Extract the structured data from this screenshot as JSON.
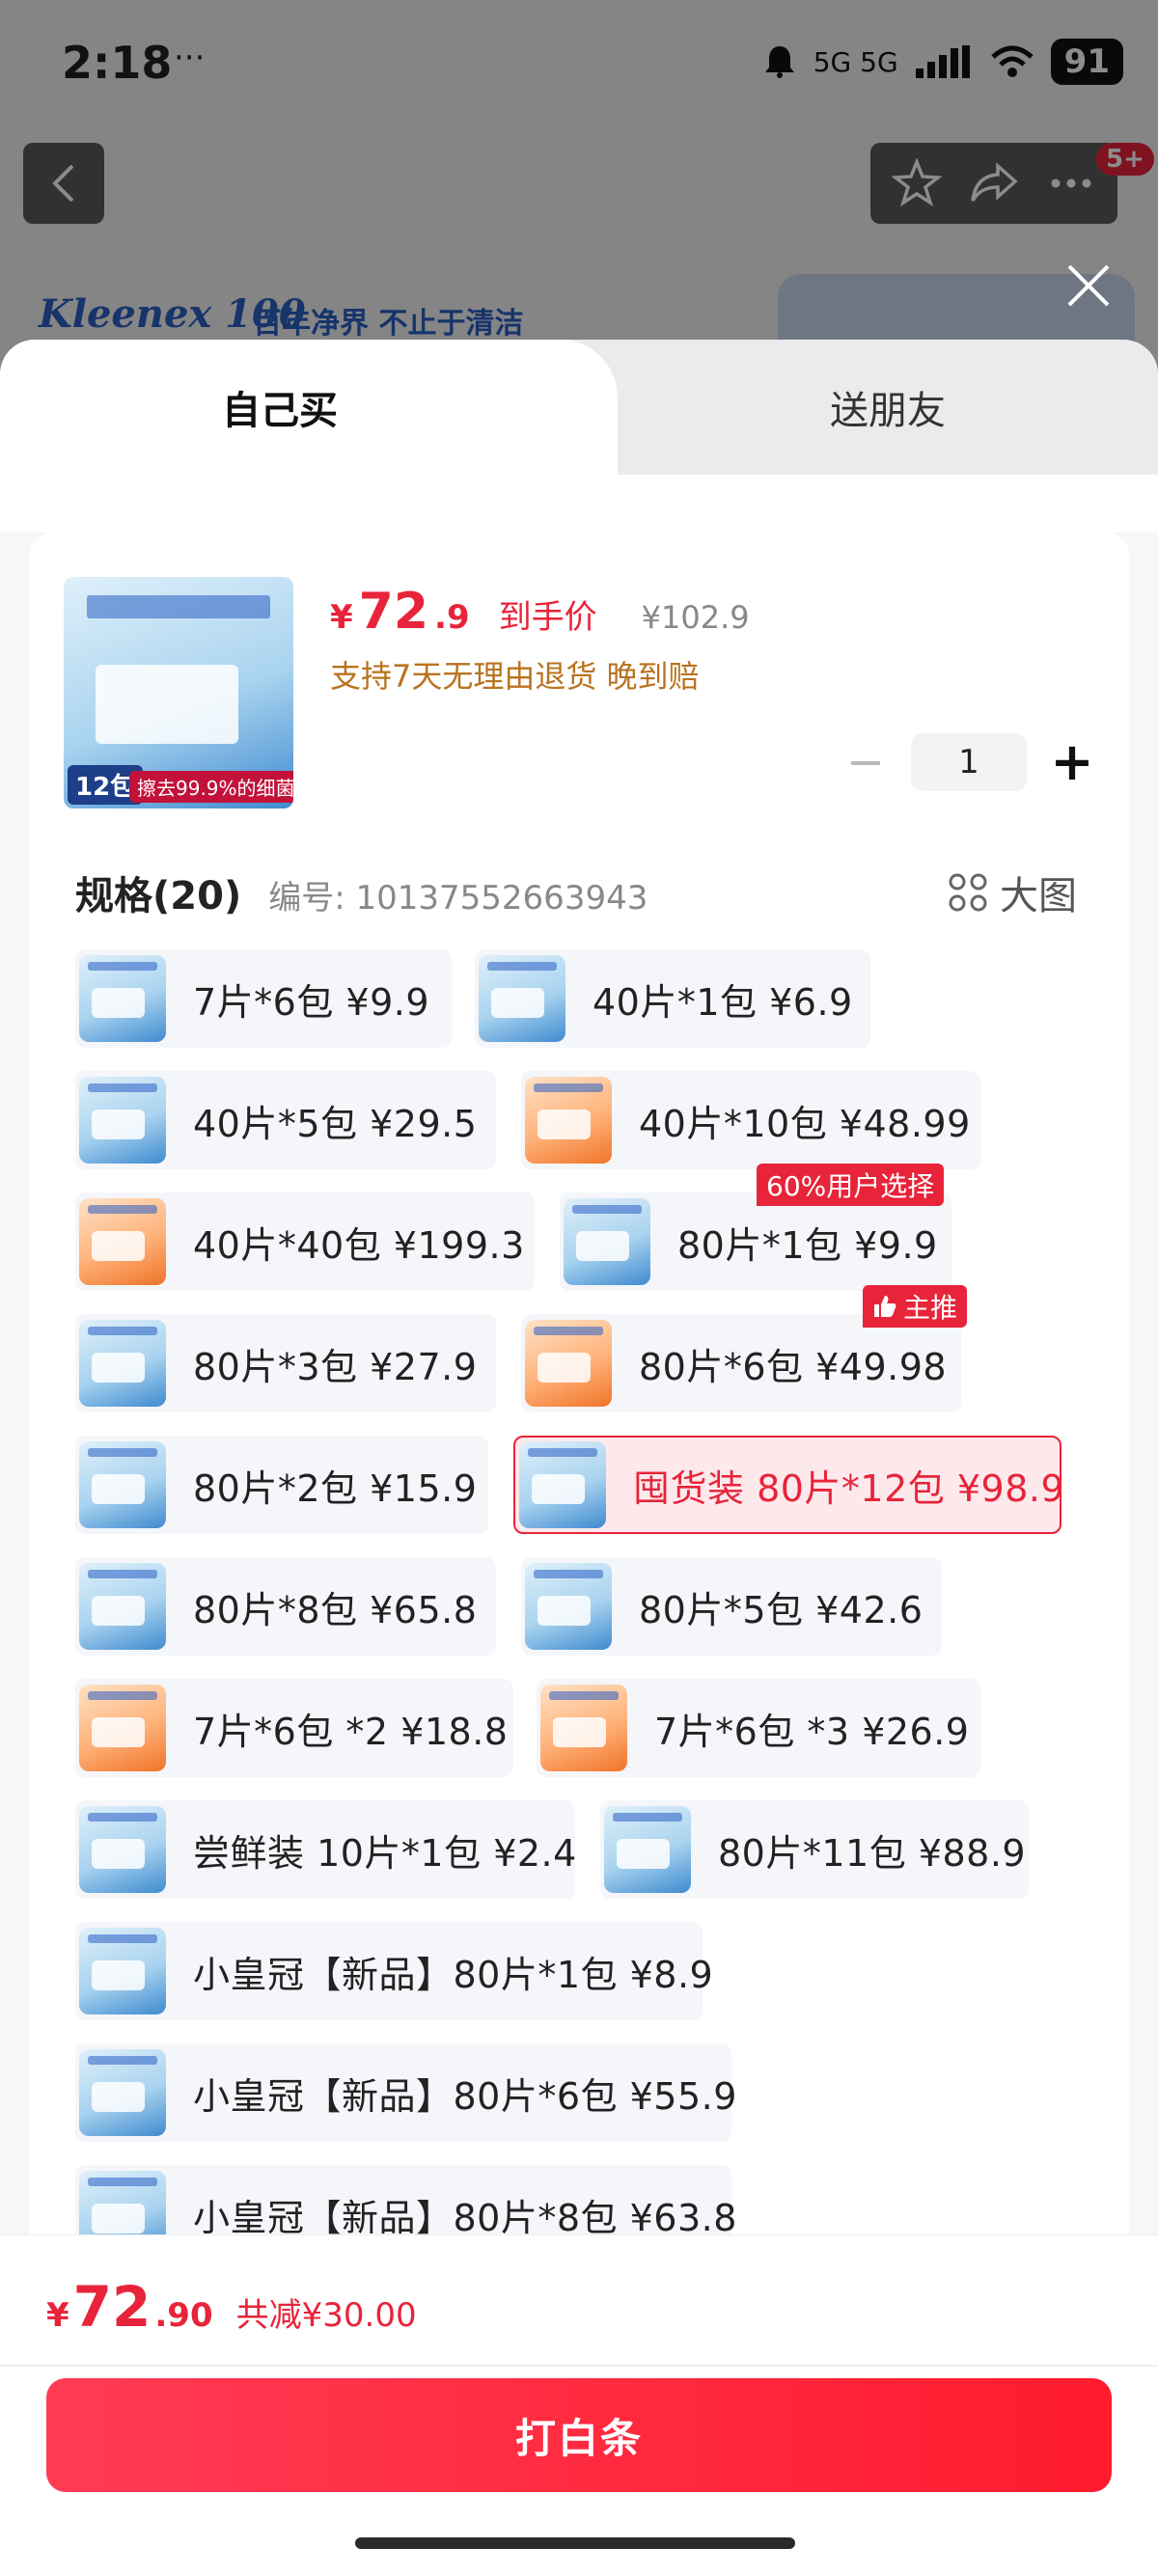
{
  "status_bar": {
    "time": "2:18",
    "dots": "···",
    "network": "5G 5G",
    "battery": "91"
  },
  "nav": {
    "badge": "5+"
  },
  "banner": {
    "logo": "Kleenex 100",
    "slogan": "百年净界 不止于清洁"
  },
  "tabs": {
    "self": "自己买",
    "gift": "送朋友"
  },
  "product": {
    "currency": "¥",
    "price_int": "72",
    "price_dec": ".9",
    "price_label": "到手价",
    "original_price": "¥102.9",
    "policy": "支持7天无理由退货  晚到赔",
    "image_count": "12包",
    "image_tagline": "擦去99.9%的细菌"
  },
  "quantity": {
    "minus": "−",
    "value": "1",
    "plus": "+"
  },
  "spec": {
    "title": "规格(20)",
    "code": "编号: 10137552663943",
    "big_image": "大图"
  },
  "options": [
    {
      "label": "7片*6包  ¥9.9",
      "color": "blue"
    },
    {
      "label": "40片*1包  ¥6.9",
      "color": "blue"
    },
    {
      "label": "40片*5包  ¥29.5",
      "color": "blue"
    },
    {
      "label": "40片*10包  ¥48.99",
      "color": "orange"
    },
    {
      "label": "40片*40包  ¥199.3",
      "color": "orange"
    },
    {
      "label": "80片*1包  ¥9.9",
      "color": "blue",
      "badge": "60%用户选择"
    },
    {
      "label": "80片*3包  ¥27.9",
      "color": "blue"
    },
    {
      "label": "80片*6包  ¥49.98",
      "color": "orange",
      "badge": "主推"
    },
    {
      "label": "80片*2包  ¥15.9",
      "color": "blue"
    },
    {
      "label": "囤货装 80片*12包  ¥98.9",
      "color": "blue",
      "selected": true
    },
    {
      "label": "80片*8包  ¥65.8",
      "color": "blue"
    },
    {
      "label": "80片*5包  ¥42.6",
      "color": "blue"
    },
    {
      "label": "7片*6包 *2  ¥18.8",
      "color": "orange"
    },
    {
      "label": "7片*6包 *3  ¥26.9",
      "color": "orange"
    },
    {
      "label": "尝鲜装 10片*1包  ¥2.4",
      "color": "blue"
    },
    {
      "label": "80片*11包  ¥88.9",
      "color": "blue"
    },
    {
      "label": "小皇冠【新品】80片*1包  ¥8.9",
      "color": "blue"
    },
    {
      "label": "小皇冠【新品】80片*6包  ¥55.9",
      "color": "blue"
    },
    {
      "label": "小皇冠【新品】80片*8包  ¥63.8",
      "color": "blue"
    }
  ],
  "footer": {
    "currency": "¥",
    "total_int": "72",
    "total_dec": ".90",
    "savings": "共减¥30.00",
    "pay_button": "打白条"
  },
  "colors": {
    "accent": "#e8243a",
    "policy": "#b9731f",
    "brand_blue": "#2a5fc4"
  }
}
